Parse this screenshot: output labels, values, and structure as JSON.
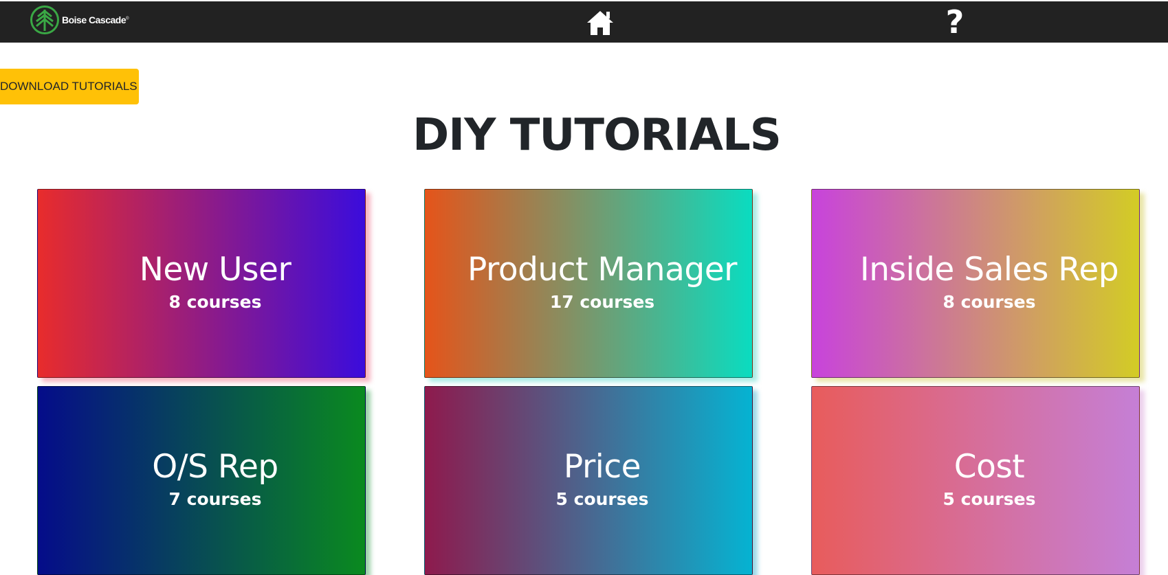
{
  "header": {
    "brand_name": "Boise Cascade",
    "brand_mark": "®",
    "logo_icon": "tree-logo-icon",
    "home_icon": "home-icon",
    "help_icon": "question-mark-icon",
    "help_glyph": "?"
  },
  "toolbar": {
    "download_label": "DOWNLOAD TUTORIALS"
  },
  "main": {
    "title": "DIY TUTORIALS",
    "cards": [
      {
        "title": "New User",
        "count": "8 courses",
        "gradient": [
          "#e82c2c",
          "#3b0cdc"
        ]
      },
      {
        "title": "Product Manager",
        "count": "17 courses",
        "gradient": [
          "#e5541a",
          "#0adcc0"
        ]
      },
      {
        "title": "Inside Sales Rep",
        "count": "8 courses",
        "gradient": [
          "#c843dc",
          "#d3cc25"
        ]
      },
      {
        "title": "O/S Rep",
        "count": "7 courses",
        "gradient": [
          "#050c8a",
          "#0a8a1f"
        ]
      },
      {
        "title": "Price",
        "count": "5 courses",
        "gradient": [
          "#8e1a4d",
          "#05b3d2"
        ]
      },
      {
        "title": "Cost",
        "count": "5 courses",
        "gradient": [
          "#e85c5c",
          "#c57fd6"
        ]
      }
    ]
  },
  "colors": {
    "header_bg": "#222222",
    "brand_green": "#3aa845",
    "download_button": "#ffc107",
    "title_text": "#212529"
  }
}
